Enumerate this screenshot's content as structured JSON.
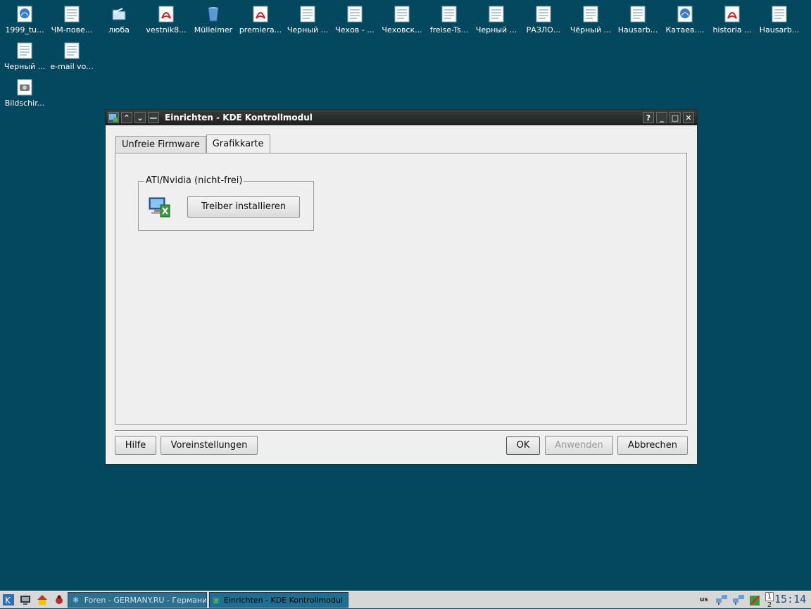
{
  "desktop": {
    "icons": [
      {
        "label": "1999_tu...",
        "icon": "web-icon"
      },
      {
        "label": "ЧМ-пове...",
        "icon": "document-icon"
      },
      {
        "label": "люба",
        "icon": "folder-icon"
      },
      {
        "label": "vestnik8...",
        "icon": "pdf-icon"
      },
      {
        "label": "Mülleimer",
        "icon": "trash-icon"
      },
      {
        "label": "premiera...",
        "icon": "pdf-icon"
      },
      {
        "label": "Черный ...",
        "icon": "document-icon"
      },
      {
        "label": "Чехов - ...",
        "icon": "document-icon"
      },
      {
        "label": "Чеховск...",
        "icon": "document-icon"
      },
      {
        "label": "freise-Ts...",
        "icon": "document-icon"
      },
      {
        "label": "Черный ...",
        "icon": "document-icon"
      },
      {
        "label": "РАЗЛО...",
        "icon": "document-icon"
      },
      {
        "label": "Чёрный ...",
        "icon": "document-icon"
      },
      {
        "label": "Hausarb...",
        "icon": "document-icon"
      },
      {
        "label": "Катаев....",
        "icon": "web-icon"
      },
      {
        "label": "historia ...",
        "icon": "pdf-icon"
      },
      {
        "label": "Hausarb...",
        "icon": "document-icon"
      },
      {
        "label": "Черный ...",
        "icon": "document-icon"
      },
      {
        "label": "e-mail vo...",
        "icon": "document-icon"
      },
      {
        "label": "Bildschir...",
        "icon": "screenshot-icon"
      }
    ]
  },
  "window": {
    "title": "Einrichten - KDE Kontrollmodul",
    "tabs": [
      {
        "label": "Unfreie Firmware",
        "active": false
      },
      {
        "label": "Grafikkarte",
        "active": true
      }
    ],
    "group": {
      "legend": "ATI/Nvidia (nicht-frei)",
      "button": "Treiber installieren"
    },
    "buttons": {
      "help": "Hilfe",
      "defaults": "Voreinstellungen",
      "ok": "OK",
      "apply": "Anwenden",
      "cancel": "Abbrechen"
    }
  },
  "taskbar": {
    "tasks": [
      {
        "label": "Foren - GERMANY.RU - Германия r",
        "active": false
      },
      {
        "label": "Einrichten - KDE Kontrollmodul",
        "active": true
      }
    ],
    "keyboard": "us",
    "desktops": [
      "1",
      "2"
    ],
    "clock": "15:14"
  },
  "colors": {
    "desktop_bg": "#04485f",
    "titlebar": "#2a2a2a",
    "window_bg": "#efefef",
    "taskbar_bg": "#d7d7d7",
    "active_task": "#1e6f90",
    "clock": "#1f4f7a"
  }
}
